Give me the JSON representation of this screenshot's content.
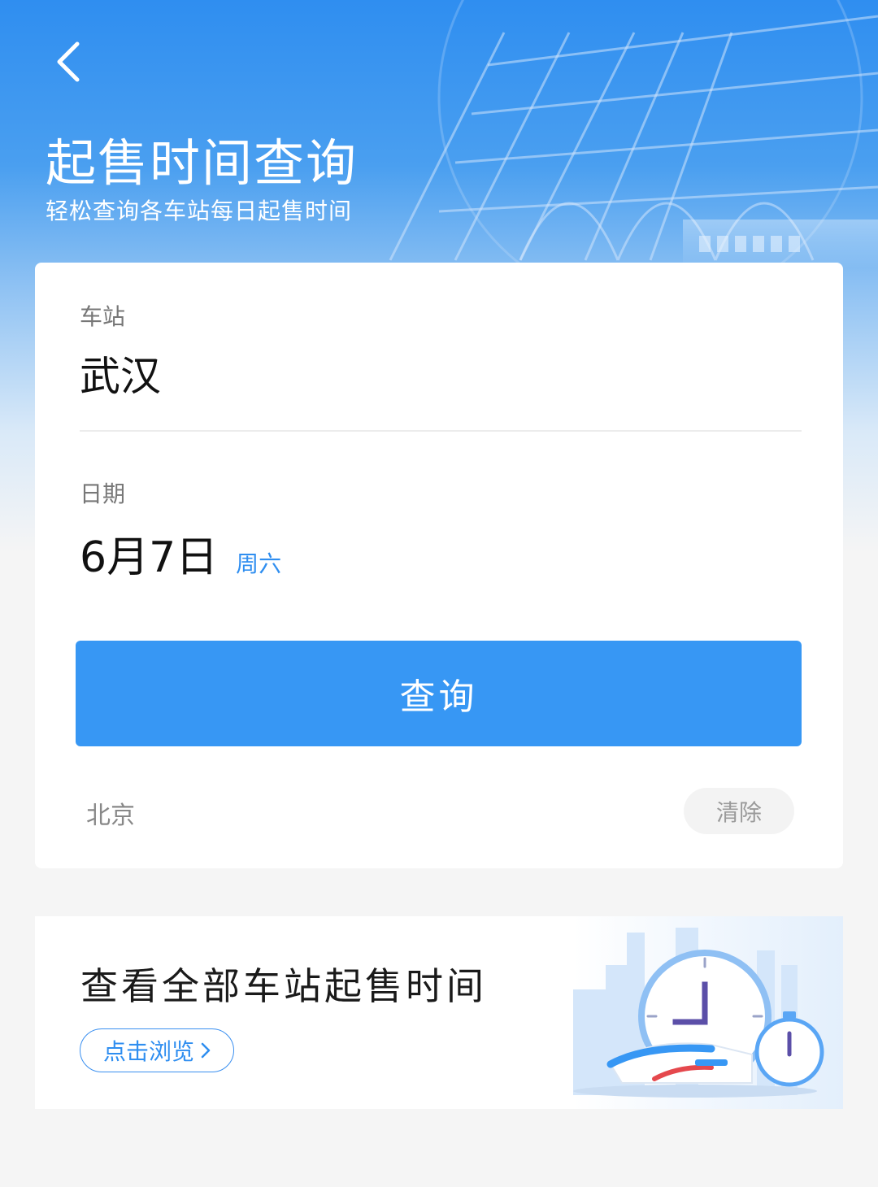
{
  "header": {
    "back_icon": "chevron-left-icon",
    "title": "起售时间查询",
    "subtitle": "轻松查询各车站每日起售时间"
  },
  "form": {
    "station_label": "车站",
    "station_value": "武汉",
    "date_label": "日期",
    "date_value": "6月7日",
    "weekday": "周六",
    "query_button": "查询",
    "history": [
      "北京"
    ],
    "clear_button": "清除"
  },
  "promo": {
    "title": "查看全部车站起售时间",
    "link_label": "点击浏览",
    "link_icon": "chevron-right-icon",
    "illustration": "clock-train-illustration"
  },
  "colors": {
    "primary": "#3797f4",
    "accent_text": "#2f8ef0"
  }
}
